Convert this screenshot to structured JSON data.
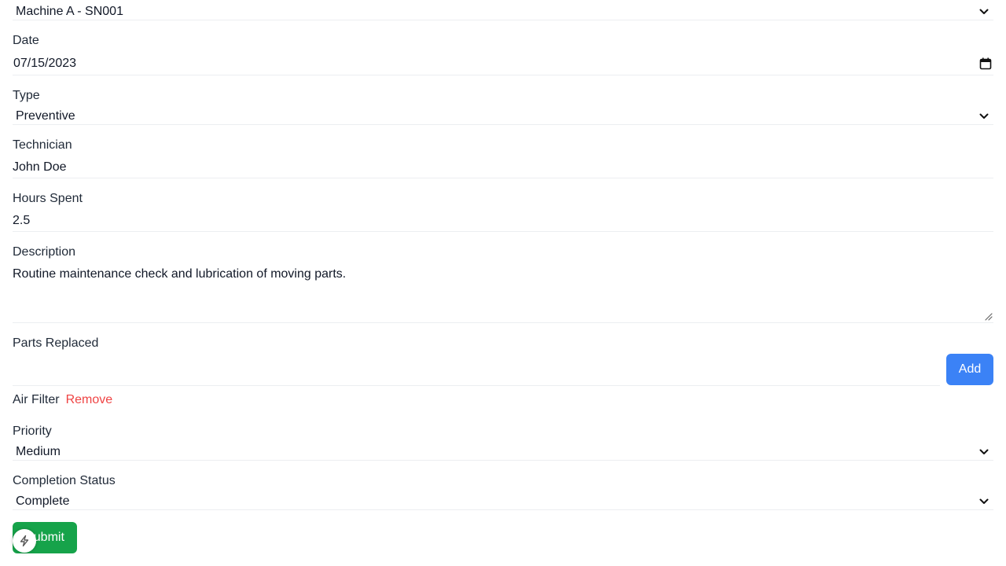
{
  "machine": {
    "value": "Machine A - SN001"
  },
  "date": {
    "label": "Date",
    "value": "07/15/2023"
  },
  "type": {
    "label": "Type",
    "value": "Preventive"
  },
  "technician": {
    "label": "Technician",
    "value": "John Doe"
  },
  "hours": {
    "label": "Hours Spent",
    "value": "2.5"
  },
  "description": {
    "label": "Description",
    "value": "Routine maintenance check and lubrication of moving parts."
  },
  "parts": {
    "label": "Parts Replaced",
    "input_value": "",
    "add_label": "Add",
    "items": [
      {
        "name": "Air Filter",
        "remove_label": "Remove"
      }
    ]
  },
  "priority": {
    "label": "Priority",
    "value": "Medium"
  },
  "completion": {
    "label": "Completion Status",
    "value": "Complete"
  },
  "submit": {
    "label": "Submit"
  },
  "colors": {
    "add_button": "#3b82f6",
    "submit_button": "#16a34a",
    "remove_link": "#ef4444"
  },
  "icons": {
    "select": "chevron-down-icon",
    "date": "calendar-icon",
    "textarea": "resize-handle-icon",
    "badge": "lightning-icon"
  }
}
